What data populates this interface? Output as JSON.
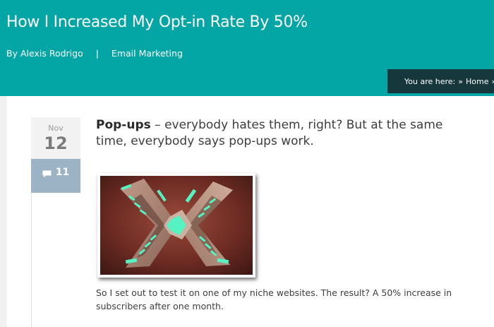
{
  "post": {
    "title": "How I Increased My Opt-in Rate By 50%",
    "author_prefix": "By",
    "author": "Alexis Rodrigo",
    "separator": "|",
    "category": "Email Marketing"
  },
  "breadcrumb": {
    "prefix": "You are here:",
    "sep1": "»",
    "home": "Home",
    "sep2": "»"
  },
  "date": {
    "month": "Nov",
    "day": "12"
  },
  "comments": {
    "count": "11",
    "icon": "comment-bubble-icon"
  },
  "intro": {
    "bold": "Pop-ups",
    "rest": " – everybody hates them, right? But at the same time, everybody says pop-ups work."
  },
  "body": {
    "paragraph": "So I set out to test it on one of my niche websites. The result? A 50% increase in subscribers after one month."
  },
  "colors": {
    "header": "#03a5a5",
    "breadcrumb_bg": "#16383d",
    "comments_bg": "#9cb2c5",
    "glow": "#56f2c2"
  }
}
